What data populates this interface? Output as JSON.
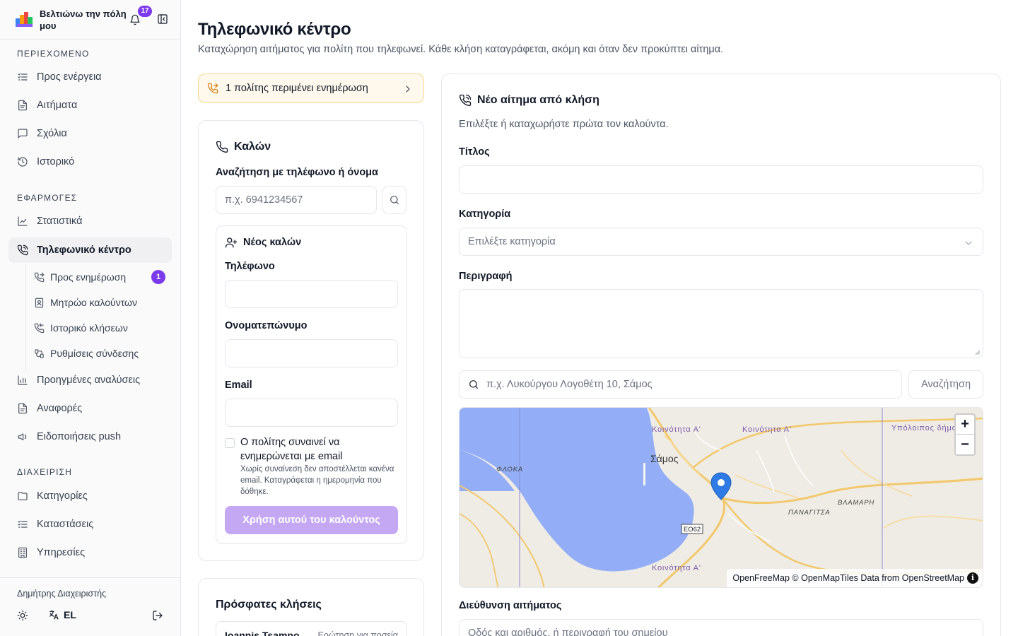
{
  "app": {
    "title": "Βελτιώνω την πόλη μου",
    "notifications_count": "17"
  },
  "sidebar": {
    "sections": {
      "content": "ΠΕΡΙΕΧΟΜΕΝΟ",
      "apps": "ΕΦΑΡΜΟΓΕΣ",
      "admin": "ΔΙΑΧΕΙΡΙΣΗ"
    },
    "content_items": [
      {
        "label": "Προς ενέργεια",
        "icon": "list-check-icon"
      },
      {
        "label": "Αιτήματα",
        "icon": "file-icon"
      },
      {
        "label": "Σχόλια",
        "icon": "message-icon"
      },
      {
        "label": "Ιστορικό",
        "icon": "history-icon"
      }
    ],
    "apps_items": [
      {
        "label": "Στατιστικά",
        "icon": "chart-line-icon"
      },
      {
        "label": "Τηλεφωνικό κέντρο",
        "icon": "phone-call-icon",
        "active": true
      }
    ],
    "call_center_sub": [
      {
        "label": "Προς ενημέρωση",
        "icon": "phone-forward-icon",
        "badge": "1"
      },
      {
        "label": "Μητρώο καλούντων",
        "icon": "contact-book-icon"
      },
      {
        "label": "Ιστορικό κλήσεων",
        "icon": "phone-history-icon"
      },
      {
        "label": "Ρυθμίσεις σύνδεσης",
        "icon": "connection-settings-icon"
      }
    ],
    "apps_items_after": [
      {
        "label": "Προηγμένες αναλύσεις",
        "icon": "bar-chart-icon"
      },
      {
        "label": "Αναφορές",
        "icon": "file-icon"
      },
      {
        "label": "Ειδοποιήσεις push",
        "icon": "megaphone-icon"
      }
    ],
    "admin_items": [
      {
        "label": "Κατηγορίες",
        "icon": "folder-icon"
      },
      {
        "label": "Καταστάσεις",
        "icon": "list-check-icon"
      },
      {
        "label": "Υπηρεσίες",
        "icon": "building-icon"
      }
    ],
    "footer": {
      "user": "Δημήτρης Διαχειριστής",
      "language": "EL"
    }
  },
  "page": {
    "title": "Τηλεφωνικό κέντρο",
    "subtitle": "Καταχώρηση αιτήματος για πολίτη που τηλεφωνεί. Κάθε κλήση καταγράφεται, ακόμη και όταν δεν προκύπτει αίτημα.",
    "pending_banner": "1 πολίτης περιμένει ενημέρωση"
  },
  "caller": {
    "title": "Καλών",
    "search_label": "Αναζήτηση με τηλέφωνο ή όνομα",
    "search_placeholder": "π.χ. 6941234567",
    "new_caller": {
      "title": "Νέος καλών",
      "phone_label": "Τηλέφωνο",
      "name_label": "Ονοματεπώνυμο",
      "email_label": "Email",
      "consent_label": "Ο πολίτης συναινεί να ενημερώνεται με email",
      "consent_help": "Χωρίς συναίνεση δεν αποστέλλεται κανένα email. Καταγράφεται η ημερομηνία που δόθηκε.",
      "use_button": "Χρήση αυτού του καλούντος"
    }
  },
  "recent": {
    "title": "Πρόσφατες κλήσεις",
    "rows": [
      {
        "name": "Ioannis Tsampo",
        "title": "Ερώτηση για ποσεία"
      }
    ]
  },
  "request": {
    "title": "Νέο αίτημα από κλήση",
    "hint": "Επιλέξτε ή καταχωρήστε πρώτα τον καλούντα.",
    "title_label": "Τίτλος",
    "category_label": "Κατηγορία",
    "category_placeholder": "Επιλέξτε κατηγορία",
    "description_label": "Περιγραφή",
    "address_search_placeholder": "π.χ. Λυκούργου Λογοθέτη 10, Σάμος",
    "address_search_button": "Αναζήτηση",
    "address_label": "Διεύθυνση αιτήματος",
    "address_placeholder": "Οδός και αριθμός, ή περιγραφή του σημείου"
  },
  "map": {
    "labels": {
      "community_1": "Κοινότητα Α'",
      "community_2": "Κοινότητα Α'",
      "community_3": "Κοινότητα Α'",
      "municipality": "Υπόλοιπος δήμος",
      "town": "Σάμος",
      "floka": "ΦΛΟΚΑ",
      "panagitsa": "ΠΑΝΑΓΙΤΣΑ",
      "vlamari": "ΒΛΑΜΑΡΗ",
      "road": "ΕΟ62"
    },
    "attribution": "OpenFreeMap © OpenMapTiles Data from OpenStreetMap",
    "zoom_in": "+",
    "zoom_out": "−",
    "info": "i"
  },
  "colors": {
    "accent": "#7c3aed",
    "accent_disabled": "#c4a8f4",
    "warning_bg": "#fef9ec",
    "warning_border": "#f6d890",
    "water": "#93aef7",
    "land": "#efece6",
    "road": "#f2c86b",
    "marker": "#2f7be5"
  }
}
